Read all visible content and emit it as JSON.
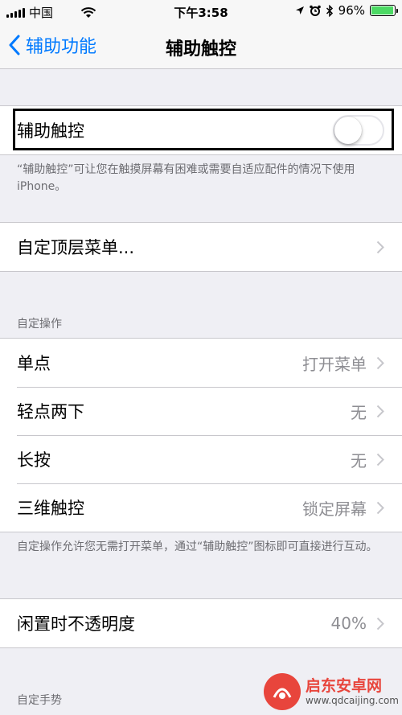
{
  "status_bar": {
    "carrier": "中国",
    "time": "下午3:58",
    "battery": "96%",
    "battery_level": 0.96
  },
  "nav": {
    "back_label": "辅助功能",
    "title": "辅助触控"
  },
  "assistive_touch": {
    "label": "辅助触控",
    "enabled": false,
    "description": "“辅助触控”可让您在触摸屏幕有困难或需要自适应配件的情况下使用 iPhone。"
  },
  "customize_menu": {
    "label": "自定顶层菜单..."
  },
  "custom_actions": {
    "header": "自定操作",
    "items": [
      {
        "label": "单点",
        "value": "打开菜单"
      },
      {
        "label": "轻点两下",
        "value": "无"
      },
      {
        "label": "长按",
        "value": "无"
      },
      {
        "label": "三维触控",
        "value": "锁定屏幕"
      }
    ],
    "footer": "自定操作允许您无需打开菜单，通过“辅助触控”图标即可直接进行互动。"
  },
  "idle_opacity": {
    "label": "闲置时不透明度",
    "value": "40%"
  },
  "custom_gestures": {
    "header": "自定手势"
  },
  "watermark": {
    "title": "启东安卓网",
    "url": "www.qdcaijing.com"
  },
  "colors": {
    "accent": "#007aff",
    "battery_green": "#4cd964",
    "watermark_red": "#e8453c"
  }
}
